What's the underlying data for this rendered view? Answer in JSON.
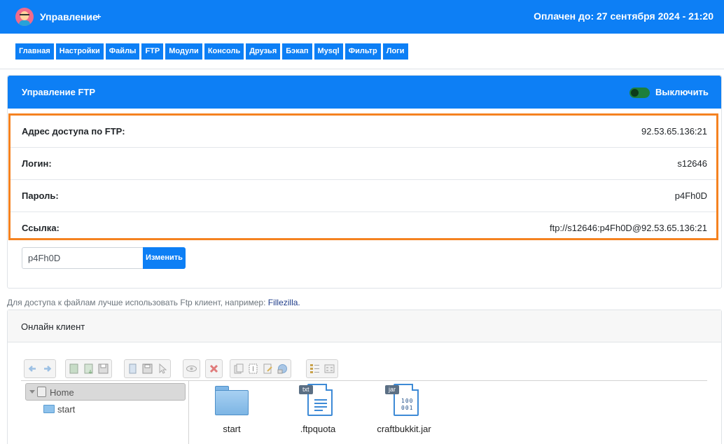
{
  "header": {
    "title": "Управление",
    "plus": "+",
    "paid_until": "Оплачен до: 27 сентября 2024 - 21:20"
  },
  "nav": [
    "Главная",
    "Настройки",
    "Файлы",
    "FTP",
    "Модули",
    "Консоль",
    "Друзья",
    "Бэкап",
    "Mysql",
    "Фильтр",
    "Логи"
  ],
  "ftp": {
    "heading": "Управление FTP",
    "toggle_label": "Выключить",
    "rows": [
      {
        "label": "Адрес доступа по FTP:",
        "value": "92.53.65.136:21"
      },
      {
        "label": "Логин:",
        "value": "s12646"
      },
      {
        "label": "Пароль:",
        "value": "p4Fh0D"
      },
      {
        "label": "Ссылка:",
        "value": "ftp://s12646:p4Fh0D@92.53.65.136:21"
      }
    ],
    "password_input_value": "p4Fh0D",
    "change_button": "Изменить"
  },
  "hint": {
    "text": "Для доступа к файлам лучше использовать Ftp клиент, например: ",
    "link": "Fillezilla."
  },
  "online_client": {
    "heading": "Онлайн клиент",
    "tree": {
      "root": "Home",
      "children": [
        "start"
      ]
    },
    "files": [
      {
        "name": "start",
        "kind": "folder"
      },
      {
        "name": ".ftpquota",
        "kind": "txt",
        "badge": "txt"
      },
      {
        "name": "craftbukkit.jar",
        "kind": "jar",
        "badge": "jar"
      }
    ],
    "toolbar_icons": [
      "back-icon",
      "forward-icon",
      "upload-icon",
      "download-icon",
      "save-icon",
      "copy-icon",
      "disk-icon",
      "pointer-icon",
      "view-icon",
      "delete-icon",
      "duplicate-icon",
      "select-icon",
      "edit-icon",
      "share-icon",
      "list-view-icon",
      "icon-view-icon"
    ]
  },
  "colors": {
    "primary": "#0d7ff5",
    "highlight_border": "#f58220",
    "toggle_on": "#1d7f3c"
  }
}
